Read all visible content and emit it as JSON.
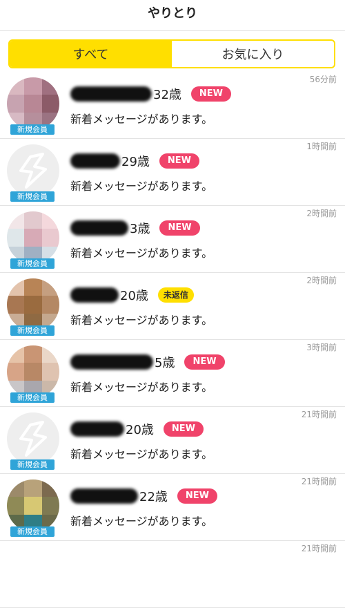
{
  "header": {
    "title": "やりとり"
  },
  "tabs": [
    {
      "label": "すべて",
      "active": true
    },
    {
      "label": "お気に入り",
      "active": false
    }
  ],
  "member_badge": "新規会員",
  "rows": [
    {
      "name_suffix": "32歳",
      "badge": "NEW",
      "badge_type": "new",
      "time": "56分前",
      "message": "新着メッセージがあります。",
      "avatar": "photo",
      "colors": [
        "#d9b8c0",
        "#c89aa8",
        "#a07080",
        "#c7a3b0",
        "#b88795",
        "#8c5b68",
        "#d7bac4",
        "#b68f9c",
        "#9b7382"
      ]
    },
    {
      "name_suffix": "29歳",
      "badge": "NEW",
      "badge_type": "new",
      "time": "1時間前",
      "message": "新着メッセージがあります。",
      "avatar": "default"
    },
    {
      "name_suffix": "3歳",
      "badge": "NEW",
      "badge_type": "new",
      "time": "2時間前",
      "message": "新着メッセージがあります。",
      "avatar": "photo",
      "colors": [
        "#f2e6e8",
        "#e2c9ce",
        "#f4d8dc",
        "#dfe7ea",
        "#d7aab6",
        "#e9c9cf",
        "#c6d2da",
        "#9fb0c3",
        "#d5dfe6"
      ]
    },
    {
      "name_suffix": "20歳",
      "badge": "未返信",
      "badge_type": "unreplied",
      "time": "2時間前",
      "message": "新着メッセージがあります。",
      "avatar": "photo",
      "colors": [
        "#e3c3ac",
        "#b88456",
        "#c59f80",
        "#a87752",
        "#9a6b3f",
        "#b48864",
        "#c9ad96",
        "#8f6a43",
        "#c4a88e"
      ]
    },
    {
      "name_suffix": "5歳",
      "badge": "NEW",
      "badge_type": "new",
      "time": "3時間前",
      "message": "新着メッセージがあります。",
      "avatar": "photo",
      "colors": [
        "#e6c3a8",
        "#c99574",
        "#ead7c8",
        "#d7a487",
        "#b88866",
        "#dfc3b0",
        "#c9c6c8",
        "#a9a7ad",
        "#cbb8a9"
      ]
    },
    {
      "name_suffix": "20歳",
      "badge": "NEW",
      "badge_type": "new",
      "time": "21時間前",
      "message": "新着メッセージがあります。",
      "avatar": "default"
    },
    {
      "name_suffix": "22歳",
      "badge": "NEW",
      "badge_type": "new",
      "time": "21時間前",
      "message": "新着メッセージがあります。",
      "avatar": "photo",
      "colors": [
        "#9c8a6a",
        "#b8a27a",
        "#7c6a4f",
        "#8f8a56",
        "#d7c873",
        "#7f7a52",
        "#5d6a4a",
        "#2f7e86",
        "#6b6a4a"
      ]
    }
  ],
  "partial_row_time": "21時間前"
}
